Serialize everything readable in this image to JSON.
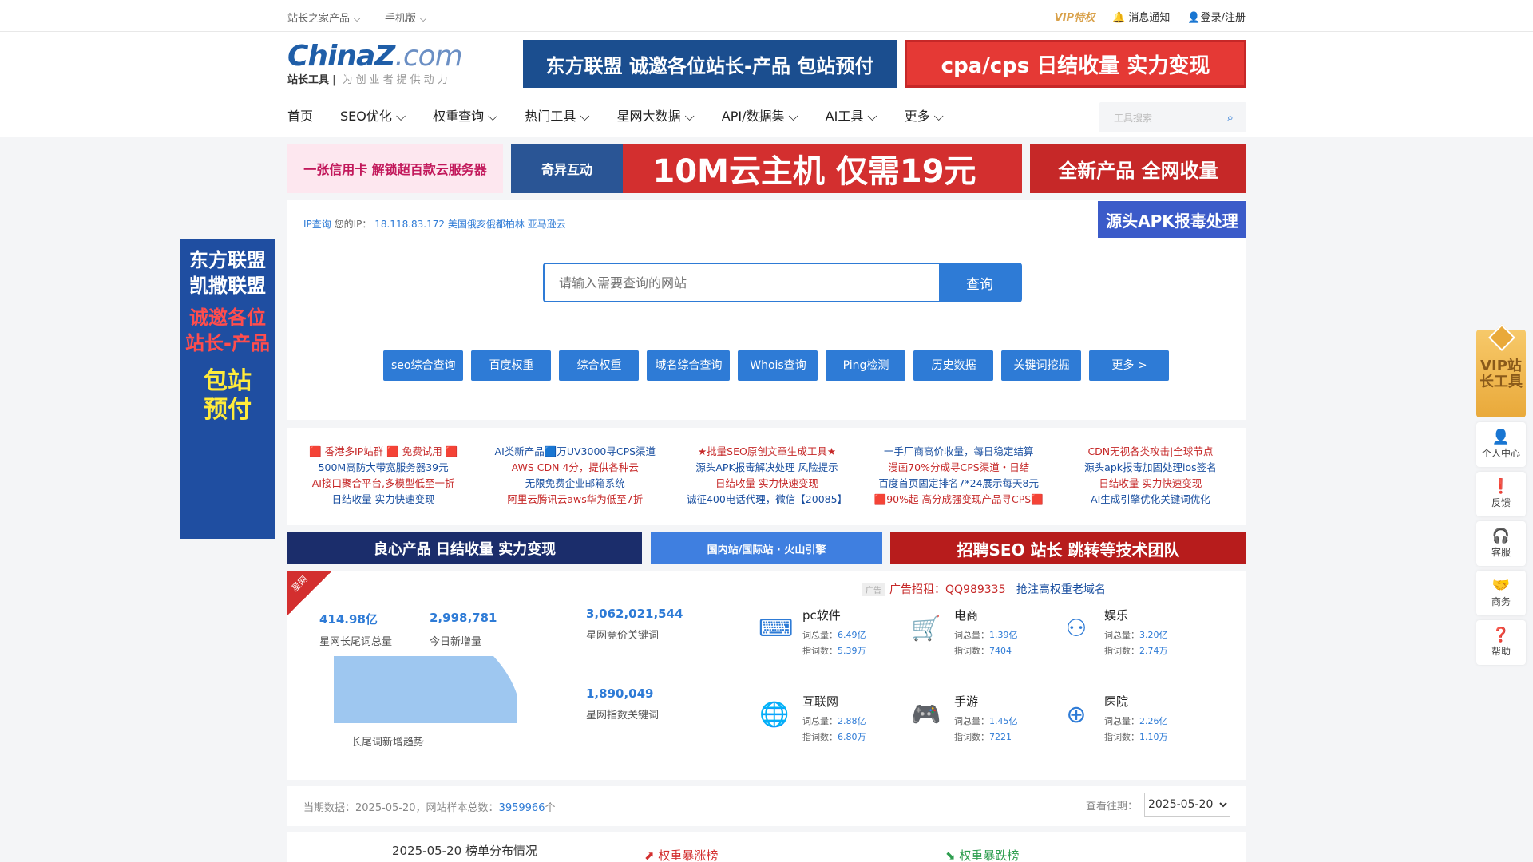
{
  "topbar": {
    "products": "站长之家产品 ⌵",
    "mobile": "手机版 ⌵",
    "vip": "VIP特权",
    "notify": "消息通知",
    "login": "登录/注册"
  },
  "logo": {
    "brand": "ChinaZ",
    "brand_suffix": ".com",
    "sub": "站长工具",
    "slogan": "为创业者提供动力"
  },
  "banners": {
    "top1": "东方联盟 诚邀各位站长-产品 包站预付",
    "top2": "cpa/cps 日结收量 实力变现",
    "row1": "一张信用卡 解锁超百款云服务器",
    "row2_logo": "奇异互动",
    "row2": "10M云主机 仅需19元",
    "row3": "全新产品 全网收量",
    "apk": "源头APK报毒处理"
  },
  "nav": {
    "items": [
      "首页",
      "SEO优化 ⌵",
      "权重查询 ⌵",
      "热门工具 ⌵",
      "星网大数据 ⌵",
      "API/数据集 ⌵",
      "AI工具 ⌵",
      "更多 ⌵"
    ],
    "search_placeholder": "工具搜索"
  },
  "ip": {
    "label": "IP查询",
    "your_ip": "您的IP：",
    "value": "18.118.83.172 美国俄亥俄都柏林 亚马逊云"
  },
  "search": {
    "placeholder": "请输入需要查询的网站",
    "button": "查询"
  },
  "quick": [
    "seo综合查询",
    "百度权重",
    "综合权重",
    "域名综合查询",
    "Whois查询",
    "Ping检测",
    "历史数据",
    "关键词挖掘",
    "更多 >"
  ],
  "side_ad": {
    "l1": "东方联盟",
    "l2": "凯撒联盟",
    "l3": "诚邀各位",
    "l4": "站长-产品",
    "l5": "包站",
    "l6": "预付"
  },
  "text_ads": [
    [
      "🟥 香港多IP站群 🟥 免费试用 🟥",
      "500M高防大带宽服务器39元",
      "AI接口聚合平台,多模型低至一折",
      "日结收量 实力快速变现"
    ],
    [
      "AI类新产品🟦万UV3000寻CPS渠道",
      "AWS CDN 4分，提供各种云",
      "无限免费企业邮箱系统",
      "阿里云腾讯云aws华为低至7折"
    ],
    [
      "★批量SEO原创文章生成工具★",
      "源头APK报毒解决处理 风险提示",
      "日结收量 实力快速变现",
      "诚征400电话代理，微信【20085】"
    ],
    [
      "一手厂商高价收量，每日稳定结算",
      "漫画70%分成寻CPS渠道・日结",
      "百度首页固定排名7*24展示每天8元",
      "🟥90%起 高分成强变现产品寻CPS🟥"
    ],
    [
      "CDN无视各类攻击|全球节点",
      "源头apk报毒加固处理ios签名",
      "日结收量 实力快速变现",
      "AI生成引擎优化关键词优化"
    ]
  ],
  "banners2": {
    "b1": "良心产品 日结收量 实力变现",
    "b2": "国内站/国际站 · 火山引擎",
    "b3": "招聘SEO 站长 跳转等技术团队"
  },
  "stats": {
    "corner": "星网",
    "ad_tag": "广告",
    "ad1": "广告招租：QQ989335",
    "ad2": "抢注高权重老域名",
    "total_num": "414.98亿",
    "total_lbl": "星网长尾词总量",
    "today_num": "2,998,781",
    "today_lbl": "今日新增量",
    "trend_lbl": "长尾词新增趋势",
    "bid_num": "3,062,021,544",
    "bid_lbl": "星网竞价关键词",
    "index_num": "1,890,049",
    "index_lbl": "星网指数关键词",
    "cats": [
      {
        "icon": "code-window-icon",
        "glyph": "⌨",
        "name": "pc软件",
        "total": "6.49亿",
        "index": "5.39万"
      },
      {
        "icon": "cart-icon",
        "glyph": "🛒",
        "name": "电商",
        "total": "1.39亿",
        "index": "7404"
      },
      {
        "icon": "grid-circles-icon",
        "glyph": "⚇",
        "name": "娱乐",
        "total": "3.20亿",
        "index": "2.74万"
      },
      {
        "icon": "globe-icon",
        "glyph": "🌐",
        "name": "互联网",
        "total": "2.88亿",
        "index": "6.80万"
      },
      {
        "icon": "gamepad-icon",
        "glyph": "🎮",
        "name": "手游",
        "total": "1.45亿",
        "index": "7221"
      },
      {
        "icon": "medical-kit-icon",
        "glyph": "⊕",
        "name": "医院",
        "total": "2.26亿",
        "index": "1.10万"
      }
    ],
    "total_prefix": "词总量：",
    "index_prefix": "指词数："
  },
  "datebar": {
    "current": "当期数据：2025-05-20，网站样本总数：",
    "count": "3959966",
    "unit": "个",
    "period_lbl": "查看往期：",
    "period": "2025-05-20"
  },
  "rank": {
    "title": "2025-05-20 榜单分布情况",
    "up": "⬈ 权重暴涨榜",
    "down": "⬊ 权重暴跌榜"
  },
  "float": {
    "vip": "VIP站长工具",
    "items": [
      {
        "icon": "user-icon",
        "glyph": "👤",
        "label": "个人中心"
      },
      {
        "icon": "feedback-icon",
        "glyph": "❗",
        "label": "反馈"
      },
      {
        "icon": "headset-icon",
        "glyph": "🎧",
        "label": "客服"
      },
      {
        "icon": "handshake-icon",
        "glyph": "🤝",
        "label": "商务"
      },
      {
        "icon": "help-icon",
        "glyph": "❓",
        "label": "帮助"
      }
    ]
  }
}
